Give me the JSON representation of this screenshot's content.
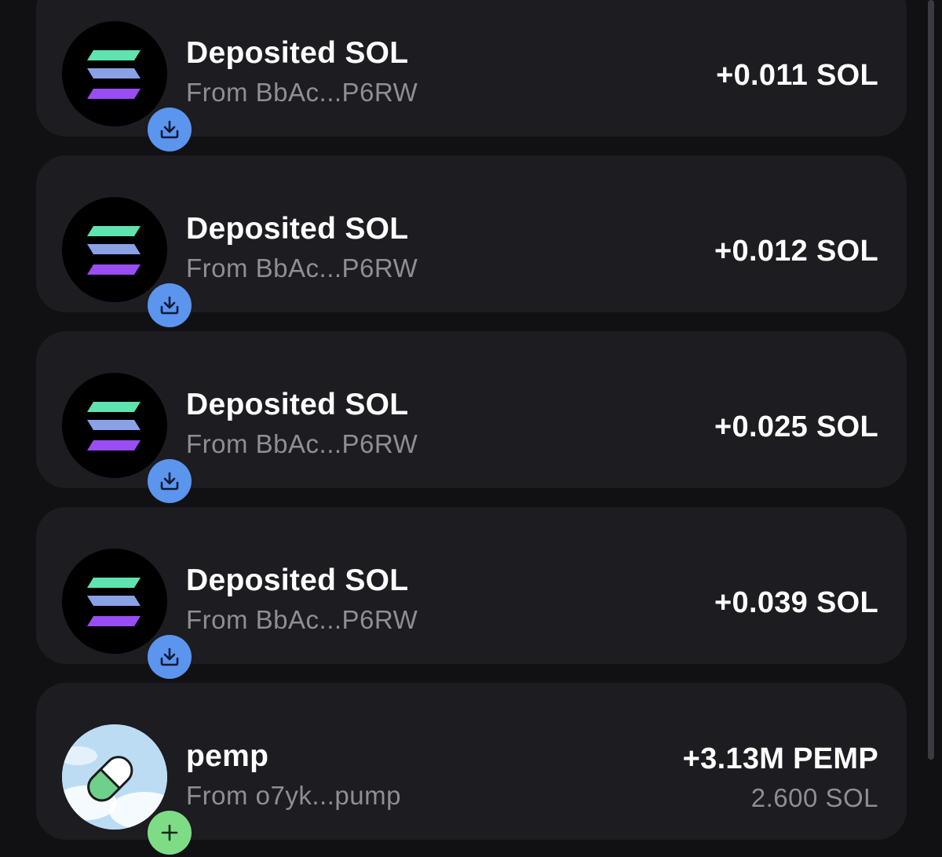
{
  "transactions": [
    {
      "title": "Deposited SOL",
      "subtitle": "From BbAc...P6RW",
      "amount": "+0.011 SOL",
      "avatar_icon": "solana-logo-icon",
      "badge_icon": "download-icon",
      "badge_color": "#5b95ee"
    },
    {
      "title": "Deposited SOL",
      "subtitle": "From BbAc...P6RW",
      "amount": "+0.012 SOL",
      "avatar_icon": "solana-logo-icon",
      "badge_icon": "download-icon",
      "badge_color": "#5b95ee"
    },
    {
      "title": "Deposited SOL",
      "subtitle": "From BbAc...P6RW",
      "amount": "+0.025 SOL",
      "avatar_icon": "solana-logo-icon",
      "badge_icon": "download-icon",
      "badge_color": "#5b95ee"
    },
    {
      "title": "Deposited SOL",
      "subtitle": "From BbAc...P6RW",
      "amount": "+0.039 SOL",
      "avatar_icon": "solana-logo-icon",
      "badge_icon": "download-icon",
      "badge_color": "#5b95ee"
    },
    {
      "title": "pemp",
      "subtitle": "From o7yk...pump",
      "amount": "+3.13M PEMP",
      "secondary": "2.600 SOL",
      "avatar_icon": "pill-token-icon",
      "badge_icon": "plus-icon",
      "badge_color": "#7edc86"
    }
  ]
}
